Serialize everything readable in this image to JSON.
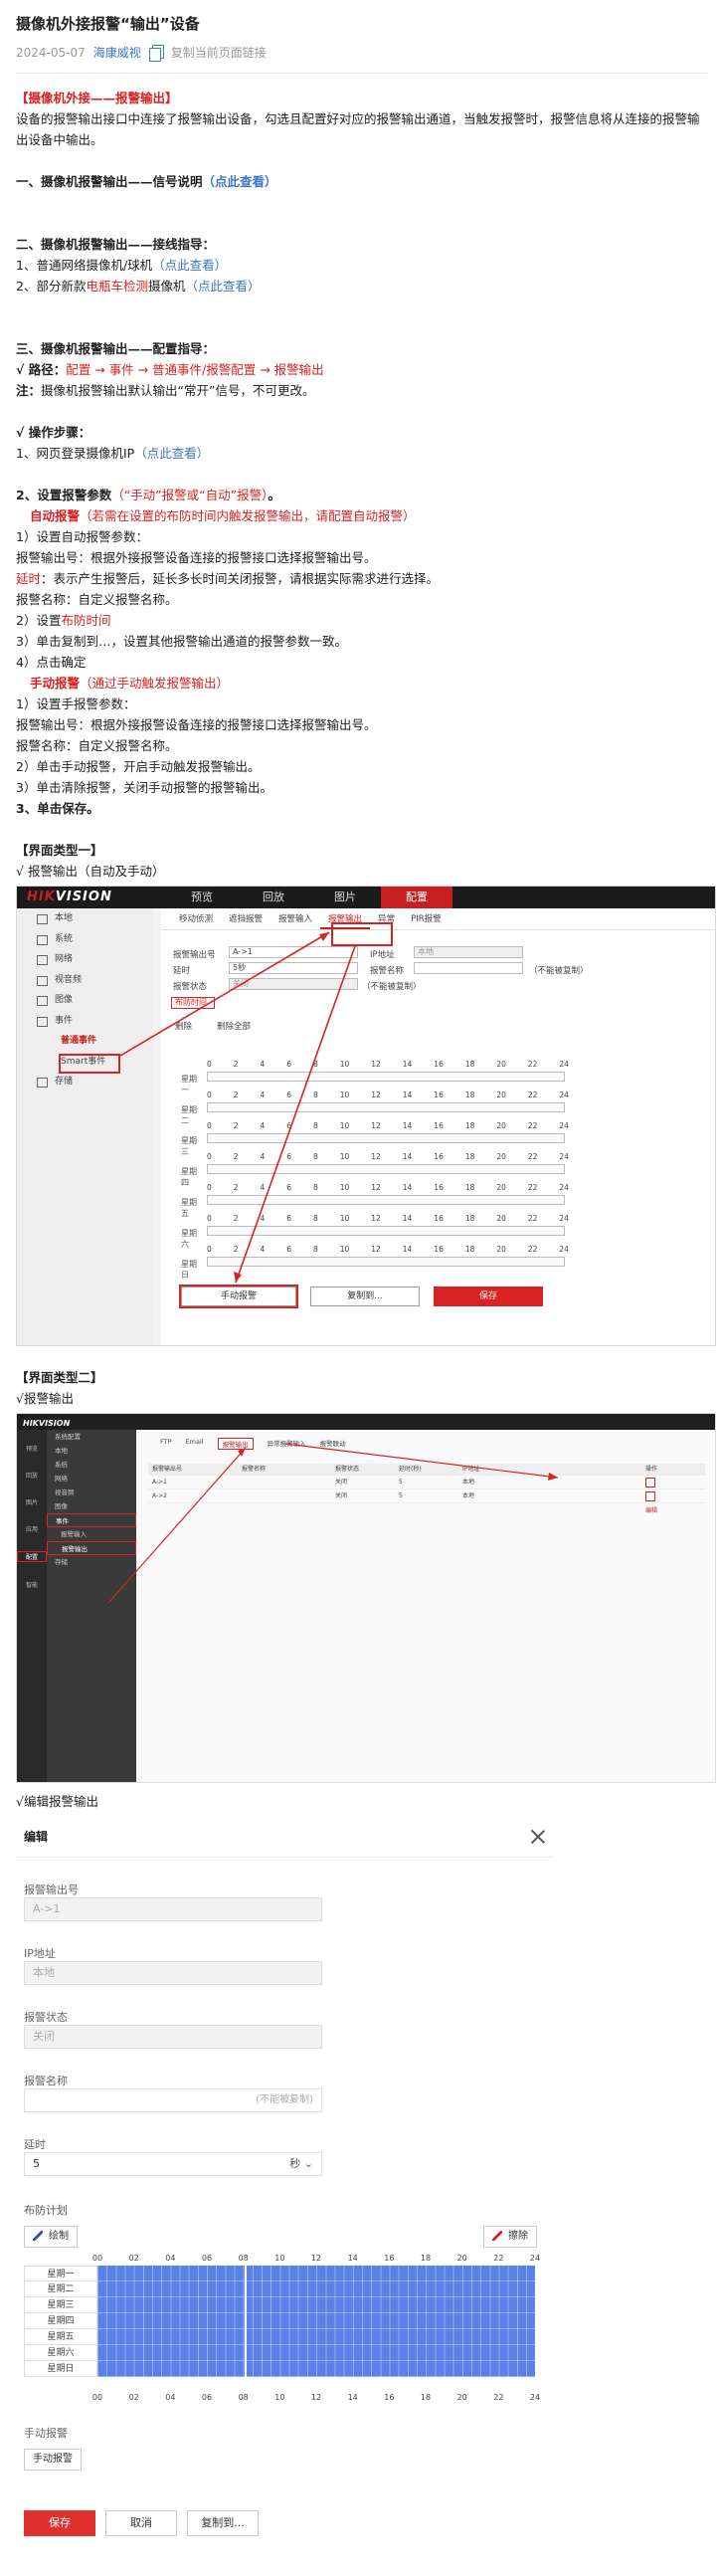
{
  "article": {
    "title": "摄像机外接报警“输出”设备",
    "date": "2024-05-07",
    "author": "海康威视",
    "copy_link": "复制当前页面链接"
  },
  "intro": {
    "heading": "【摄像机外接——报警输出】",
    "text": "设备的报警输出接口中连接了报警输出设备，勾选且配置好对应的报警输出通道，当触发报警时，报警信息将从连接的报警输出设备中输出。"
  },
  "sec1": {
    "heading": "一、摄像机报警输出——信号说明",
    "link": "（点此查看）"
  },
  "sec2": {
    "heading": "二、摄像机报警输出——接线指导：",
    "item1": "1、普通网络摄像机/球机",
    "item1_link": "（点此查看）",
    "item2_pre": "2、部分新款",
    "item2_red": "电瓶车检测",
    "item2_post": "摄像机",
    "item2_link": "（点此查看）"
  },
  "sec3": {
    "heading": "三、摄像机报警输出——配置指导：",
    "path_label": "√ 路径：",
    "path": "配置 → 事件 → 普通事件/报警配置 → 报警输出",
    "note_label": "注：",
    "note": "摄像机报警输出默认输出“常开”信号，不可更改。"
  },
  "steps": {
    "heading": "√ 操作步骤：",
    "s1_pre": "1、网页登录摄像机IP",
    "s1_link": "（点此查看）",
    "s2_pre": "2、设置报警参数",
    "s2_red": "（“手动”报警或“自动”报警）",
    "s2_post": "。",
    "auto_title": "自动报警",
    "auto_note": "（若需在设置的布防时间内触发报警输出，请配置自动报警）",
    "a1": "1）设置自动报警参数：",
    "a_out": "报警输出号：根据外接报警设备连接的报警接口选择报警输出号。",
    "a_delay_label": "延时",
    "a_delay": "：表示产生报警后，延长多长时间关闭报警，请根据实际需求进行选择。",
    "a_name": "报警名称：自定义报警名称。",
    "a2_pre": "2）设置",
    "a2_red": "布防时间",
    "a3": "3）单击复制到…，设置其他报警输出通道的报警参数一致。",
    "a4": "4）点击确定",
    "manual_title": "手动报警",
    "manual_note": "（通过手动触发报警输出）",
    "m1": "1）设置手报警参数：",
    "m_out": "报警输出号：根据外接报警设备连接的报警接口选择报警输出号。",
    "m_name": "报警名称：自定义报警名称。",
    "m2": "2）单击手动报警，开启手动触发报警输出。",
    "m3": "3）单击清除报警，关闭手动报警的报警输出。",
    "save": "3、单击保存。"
  },
  "ui1": {
    "heading": "【界面类型一】",
    "sub": "√ 报警输出（自动及手动）",
    "logo_a": "HIK",
    "logo_b": "VISION",
    "topnav": [
      "预览",
      "回放",
      "图片",
      "配置"
    ],
    "menu": [
      "本地",
      "系统",
      "网络",
      "视音频",
      "图像",
      "事件",
      "普通事件",
      "Smart事件",
      "存储"
    ],
    "tabs": [
      "移动侦测",
      "遮挡报警",
      "报警输入",
      "报警输出",
      "异常",
      "PIR报警"
    ],
    "f_out": "报警输出号",
    "f_out_val": "A->1",
    "f_ip": "IP地址",
    "f_ip_val": "本地",
    "f_delay": "延时",
    "f_delay_val": "5秒",
    "f_name": "报警名称",
    "f_name_hint": "（不能被复制）",
    "f_state": "报警状态",
    "f_state_val": "关闭",
    "f_state_hint": "（不能被复制）",
    "arm_tab": "布防时间",
    "del": "删除",
    "del_all": "删除全部",
    "hours": [
      "0",
      "2",
      "4",
      "6",
      "8",
      "10",
      "12",
      "14",
      "16",
      "18",
      "20",
      "22",
      "24"
    ],
    "days": [
      "星期一",
      "星期二",
      "星期三",
      "星期四",
      "星期五",
      "星期六",
      "星期日"
    ],
    "btn_manual": "手动报警",
    "btn_copy": "复制到...",
    "btn_save": "保存"
  },
  "ui2": {
    "heading": "【界面类型二】",
    "sub": "√报警输出",
    "logo": "HIKVISION",
    "side": [
      "预览",
      "回放",
      "图片",
      "应用",
      "配置",
      "智能"
    ],
    "menu": [
      "系统配置",
      "本地",
      "系统",
      "网络",
      "视音频",
      "图像",
      "事件",
      "报警输入",
      "报警输出",
      "存储"
    ],
    "tabs": [
      "FTP",
      "Email",
      "报警输出",
      "异常报警输入",
      "报警联动"
    ],
    "cols": [
      "报警输出号",
      "报警名称",
      "报警状态",
      "延时(秒)",
      "IP地址",
      "操作"
    ],
    "rows": [
      [
        "A->1",
        "",
        "关闭",
        "5",
        "本地"
      ],
      [
        "A->2",
        "",
        "关闭",
        "5",
        "本地"
      ]
    ],
    "edit_link": "编辑"
  },
  "edit": {
    "sub": "√编辑报警输出",
    "title": "编辑",
    "f_out": "报警输出号",
    "f_out_val": "A->1",
    "f_ip": "IP地址",
    "f_ip_val": "本地",
    "f_state": "报警状态",
    "f_state_val": "关闭",
    "f_name": "报警名称",
    "f_name_hint": "(不能被复制)",
    "f_delay": "延时",
    "f_delay_val": "5",
    "f_delay_unit": "秒",
    "sched": "布防计划",
    "draw": "绘制",
    "erase": "擦除",
    "hours": [
      "00",
      "02",
      "04",
      "06",
      "08",
      "10",
      "12",
      "14",
      "16",
      "18",
      "20",
      "22",
      "24"
    ],
    "days": [
      "星期一",
      "星期二",
      "星期三",
      "星期四",
      "星期五",
      "星期六",
      "星期日"
    ],
    "manual": "手动报警",
    "manual_btn": "手动报警",
    "save": "保存",
    "cancel": "取消",
    "copy": "复制到..."
  },
  "colors": {
    "accent": "#d92222",
    "link": "#3a78c3",
    "schedule": "#5a82e6"
  }
}
